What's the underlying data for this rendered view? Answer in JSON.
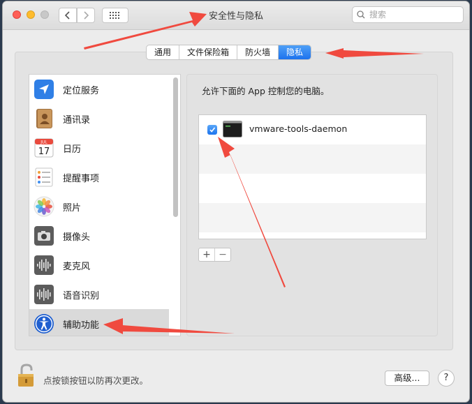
{
  "window": {
    "title": "安全性与隐私",
    "search_placeholder": "搜索"
  },
  "tabs": [
    {
      "label": "通用",
      "active": false
    },
    {
      "label": "文件保险箱",
      "active": false
    },
    {
      "label": "防火墙",
      "active": false
    },
    {
      "label": "隐私",
      "active": true
    }
  ],
  "sidebar": {
    "items": [
      {
        "label": "定位服务",
        "icon": "location-arrow-icon"
      },
      {
        "label": "通讯录",
        "icon": "contacts-book-icon"
      },
      {
        "label": "日历",
        "icon": "calendar-icon",
        "icon_month": "JUL",
        "icon_day": "17"
      },
      {
        "label": "提醒事项",
        "icon": "reminders-list-icon"
      },
      {
        "label": "照片",
        "icon": "photos-flower-icon"
      },
      {
        "label": "摄像头",
        "icon": "camera-icon"
      },
      {
        "label": "麦克风",
        "icon": "microphone-waveform-icon"
      },
      {
        "label": "语音识别",
        "icon": "speech-waveform-icon"
      },
      {
        "label": "辅助功能",
        "icon": "accessibility-person-icon",
        "selected": true
      }
    ]
  },
  "main": {
    "allow_text": "允许下面的 App 控制您的电脑。",
    "apps": [
      {
        "name": "vmware-tools-daemon",
        "checked": true,
        "icon": "terminal-icon"
      }
    ],
    "add_label": "+",
    "remove_label": "−"
  },
  "footer": {
    "lock_text": "点按锁按钮以防再次更改。",
    "advanced_label": "高级...",
    "help_label": "?"
  },
  "colors": {
    "accent": "#1c72ee",
    "annotation_arrow": "#f04a3f"
  }
}
